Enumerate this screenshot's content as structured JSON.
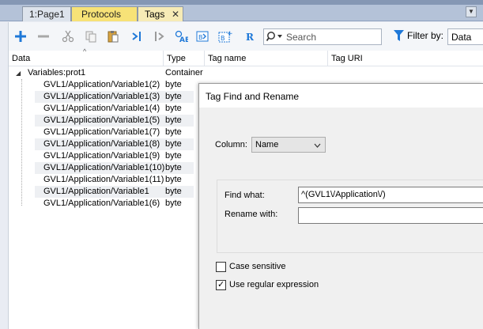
{
  "tabs": [
    {
      "label": "1:Page1"
    },
    {
      "label": "Protocols"
    },
    {
      "label": "Tags"
    }
  ],
  "toolbar": {
    "search_placeholder": "Search",
    "filter_label": "Filter by:",
    "filter_value": "Data"
  },
  "grid": {
    "columns": [
      "Data",
      "Type",
      "Tag name",
      "Tag URI"
    ],
    "root": {
      "data": "Variables:prot1",
      "type": "Container"
    },
    "rows": [
      {
        "data": "GVL1/Application/Variable1(2)",
        "type": "byte"
      },
      {
        "data": "GVL1/Application/Variable1(3)",
        "type": "byte"
      },
      {
        "data": "GVL1/Application/Variable1(4)",
        "type": "byte"
      },
      {
        "data": "GVL1/Application/Variable1(5)",
        "type": "byte"
      },
      {
        "data": "GVL1/Application/Variable1(7)",
        "type": "byte"
      },
      {
        "data": "GVL1/Application/Variable1(8)",
        "type": "byte"
      },
      {
        "data": "GVL1/Application/Variable1(9)",
        "type": "byte"
      },
      {
        "data": "GVL1/Application/Variable1(10)",
        "type": "byte"
      },
      {
        "data": "GVL1/Application/Variable1(11)",
        "type": "byte"
      },
      {
        "data": "GVL1/Application/Variable1",
        "type": "byte"
      },
      {
        "data": "GVL1/Application/Variable1(6)",
        "type": "byte"
      }
    ]
  },
  "dialog": {
    "title": "Tag Find and Rename",
    "column_label": "Column:",
    "column_value": "Name",
    "find_label": "Find what:",
    "find_value": "^(GVL1\\/Application\\/)",
    "rename_label": "Rename with:",
    "rename_value": "",
    "case_sensitive_label": "Case sensitive",
    "case_sensitive_checked": false,
    "regex_label": "Use regular expression",
    "regex_checked": true
  },
  "colors": {
    "accent_blue": "#1e78d8",
    "protocols_tab": "#f7e277",
    "tags_tab": "#f6ebb6"
  }
}
